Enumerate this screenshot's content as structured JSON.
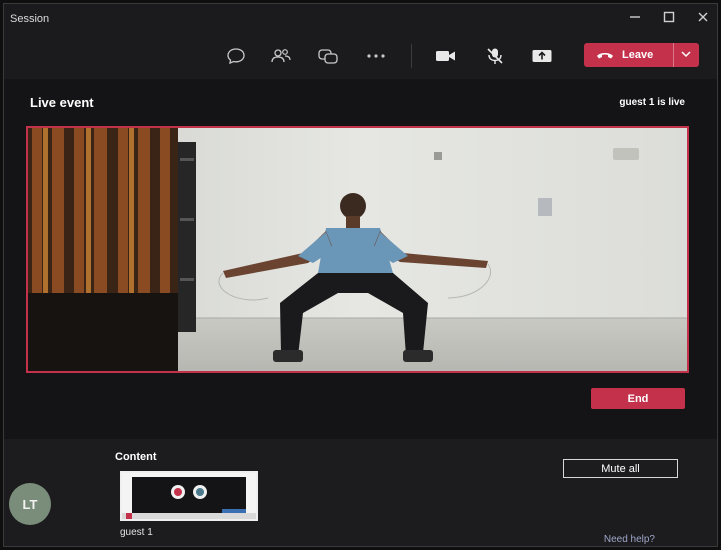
{
  "window": {
    "title": "Session"
  },
  "titlebar_icons": [
    "minimize-icon",
    "maximize-icon",
    "close-icon"
  ],
  "toolbar": {
    "icons": [
      "chat-icon",
      "participants-icon",
      "meeting-chat-icon",
      "more-icon",
      "camera-icon",
      "mic-off-icon",
      "share-icon"
    ],
    "leave_label": "Leave",
    "leave_color": "#c4314b"
  },
  "event": {
    "title": "Live event",
    "status": "guest 1 is live",
    "end_label": "End"
  },
  "content": {
    "label": "Content",
    "thumbnail_caption": "guest 1",
    "mute_all_label": "Mute all",
    "help_label": "Need help?"
  },
  "participant": {
    "initials": "LT"
  },
  "colors": {
    "accent": "#c4314b",
    "background": "#1f1f21",
    "link": "#9ea6c9"
  }
}
